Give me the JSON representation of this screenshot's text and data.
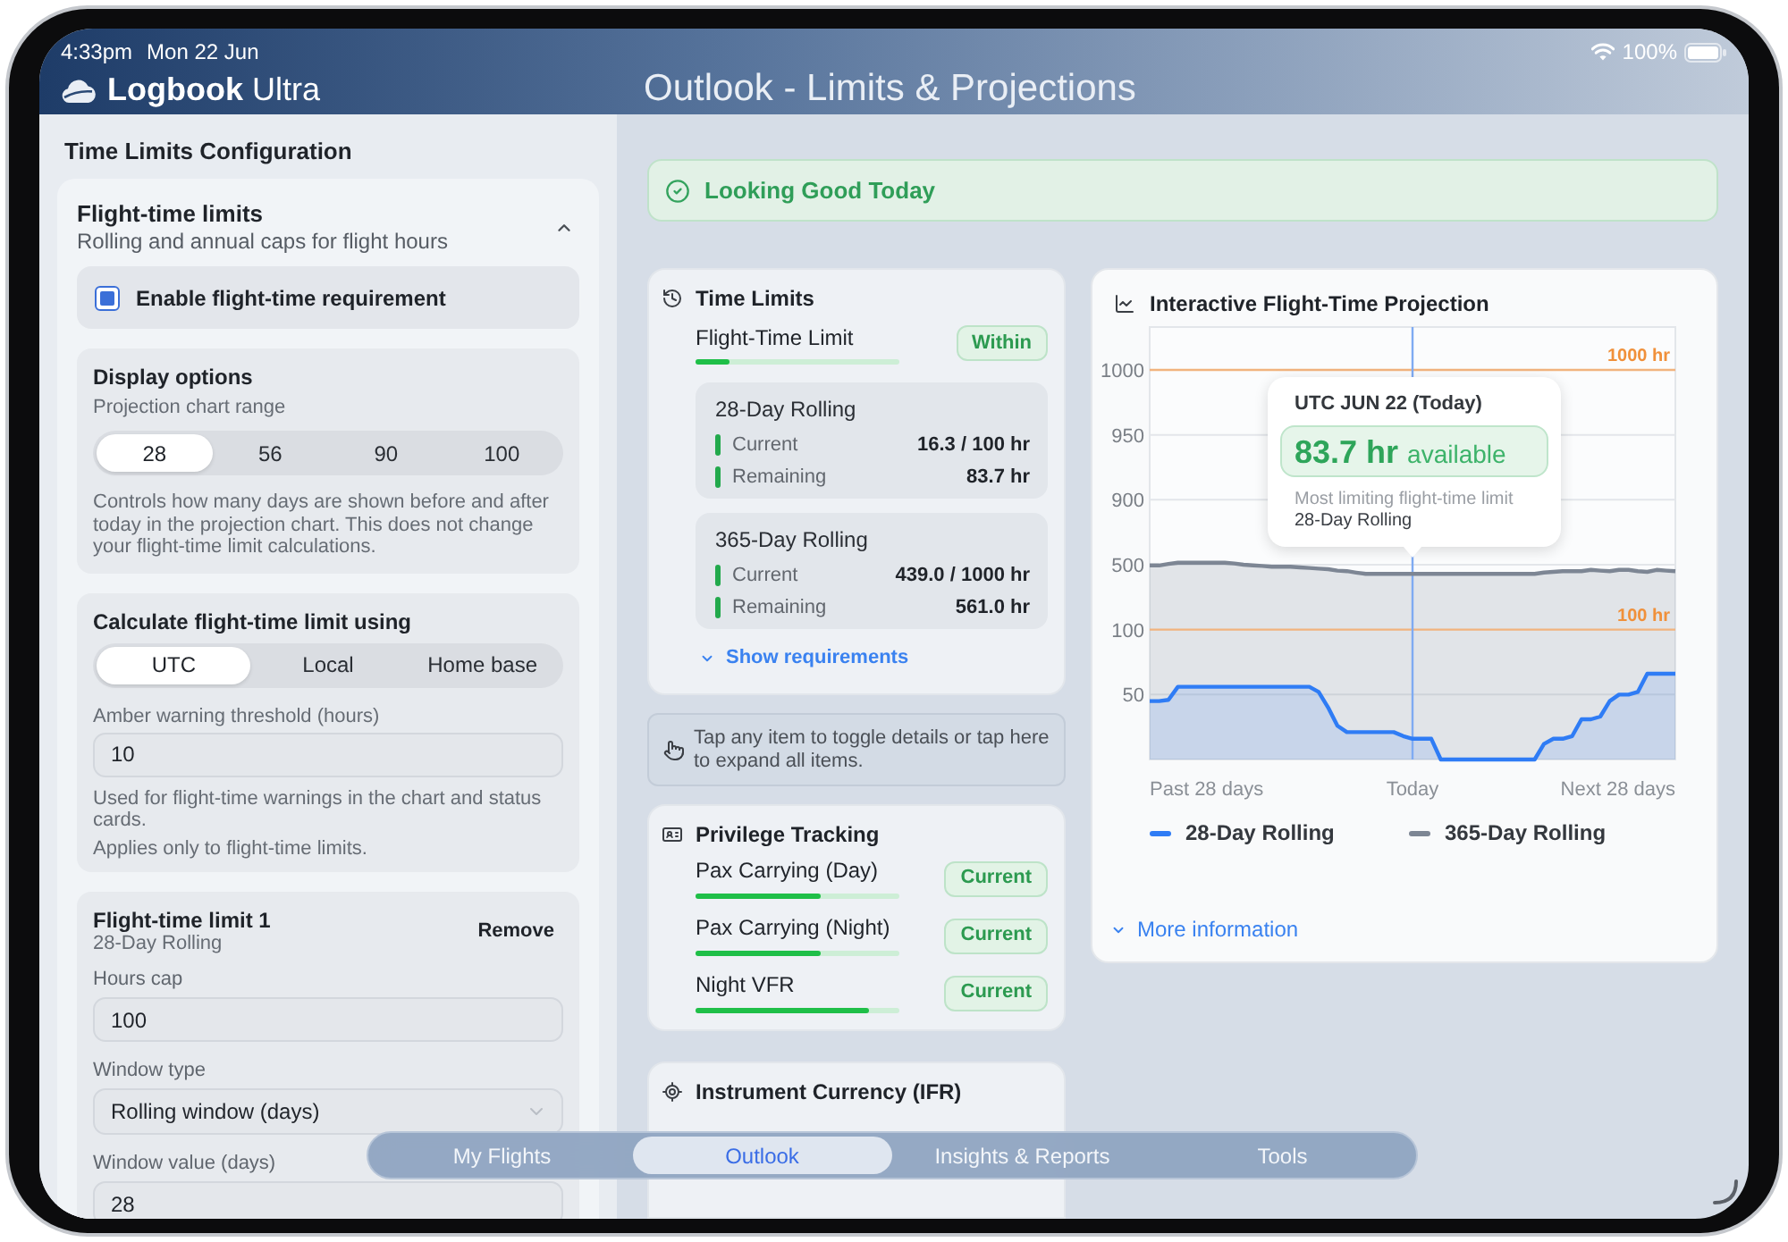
{
  "status_bar": {
    "time": "4:33pm",
    "date": "Mon 22 Jun",
    "battery": "100%"
  },
  "header": {
    "app_name": "**Logbook** Ultra",
    "title": "Outlook - Limits & Projections"
  },
  "sidebar": {
    "title": "Time Limits Configuration",
    "section": {
      "title": "Flight-time limits",
      "subtitle": "Rolling and annual caps for flight hours",
      "expanded": true,
      "enable": {
        "label": "Enable flight-time requirement",
        "checked": true
      },
      "display_options": {
        "title": "Display options",
        "label": "Projection chart range",
        "options": [
          {
            "label": "28",
            "selected": true
          },
          {
            "label": "56",
            "selected": false
          },
          {
            "label": "90",
            "selected": false
          },
          {
            "label": "100",
            "selected": false
          }
        ],
        "help": "Controls how many days are shown before and after today in the projection chart. This does not change your flight-time limit calculations."
      },
      "calculation": {
        "title": "Calculate flight-time limit using",
        "options": [
          {
            "label": "UTC",
            "selected": true
          },
          {
            "label": "Local",
            "selected": false
          },
          {
            "label": "Home base",
            "selected": false
          }
        ],
        "threshold_label": "Amber warning threshold (hours)",
        "threshold_value": "10",
        "notes": [
          "Used for flight-time warnings in the chart and status cards.",
          "Applies only to flight-time limits."
        ]
      },
      "limits": [
        {
          "title": "Flight-time limit 1",
          "subtitle": "28-Day Rolling",
          "action": "Remove",
          "fields": [
            {
              "kind": "input",
              "label": "Hours cap",
              "value": "100"
            },
            {
              "kind": "select",
              "label": "Window type",
              "value": "Rolling window (days)"
            },
            {
              "kind": "input",
              "label": "Window value (days)",
              "value": "28"
            }
          ]
        }
      ]
    }
  },
  "banner": {
    "text": "Looking Good Today"
  },
  "time_limits": {
    "title": "Time Limits",
    "limit": {
      "label": "Flight-Time Limit",
      "level": 0.163,
      "badge": "Within"
    },
    "windows": [
      {
        "title": "28-Day Rolling",
        "rows": [
          {
            "label": "Current",
            "value": "16.3 / 100 hr"
          },
          {
            "label": "Remaining",
            "value": "83.7 hr"
          }
        ]
      },
      {
        "title": "365-Day Rolling",
        "rows": [
          {
            "label": "Current",
            "value": "439.0 / 1000 hr"
          },
          {
            "label": "Remaining",
            "value": "561.0 hr"
          }
        ]
      }
    ],
    "link": "Show requirements"
  },
  "hint": {
    "text": "Tap any item to toggle details or tap here to expand all items."
  },
  "privileges": {
    "title": "Privilege Tracking",
    "items": [
      {
        "label": "Pax Carrying (Day)",
        "level": 0.61,
        "badge": "Current"
      },
      {
        "label": "Pax Carrying (Night)",
        "level": 0.61,
        "badge": "Current"
      },
      {
        "label": "Night VFR",
        "level": 0.85,
        "badge": "Current"
      }
    ]
  },
  "instrument": {
    "title": "Instrument Currency (IFR)"
  },
  "projection": {
    "title": "Interactive Flight-Time Projection",
    "y_axis": [
      {
        "label": "1000",
        "limit": "1000 hr"
      },
      {
        "label": "950"
      },
      {
        "label": "900"
      },
      {
        "label": "500"
      },
      {
        "label": "100",
        "limit": "100 hr"
      },
      {
        "label": "50"
      }
    ],
    "x_axis": [
      "Past 28 days",
      "Today",
      "Next 28 days"
    ],
    "legend": [
      {
        "label": "28-Day Rolling",
        "color": "#2f7cf5"
      },
      {
        "label": "365-Day Rolling",
        "color": "#7d8694"
      }
    ],
    "tooltip": {
      "title": "UTC JUN 22 (Today)",
      "value": "83.7 hr",
      "value_label": "available",
      "caption": "Most limiting flight-time limit",
      "detail": "28-Day Rolling"
    },
    "link": "More information"
  },
  "tab_bar": {
    "tabs": [
      {
        "label": "My Flights",
        "selected": false
      },
      {
        "label": "Outlook",
        "selected": true
      },
      {
        "label": "Insights & Reports",
        "selected": false
      },
      {
        "label": "Tools",
        "selected": false
      }
    ]
  }
}
